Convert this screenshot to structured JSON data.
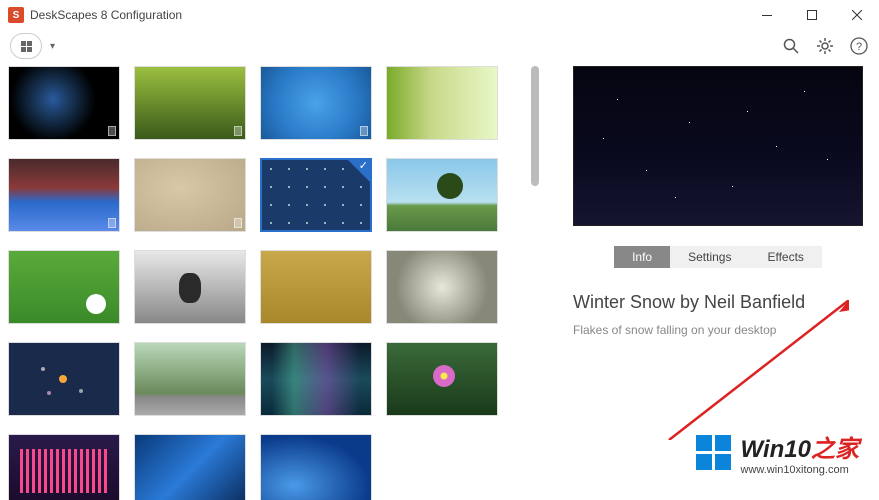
{
  "window": {
    "title": "DeskScapes 8 Configuration",
    "app_icon_letter": "S"
  },
  "details": {
    "tabs": {
      "info": "Info",
      "settings": "Settings",
      "effects": "Effects"
    },
    "title": "Winter Snow by Neil Banfield",
    "description": "Flakes of snow falling on your desktop"
  },
  "watermark": {
    "title_main": "Win10",
    "title_suffix": "之家",
    "url": "www.win10xitong.com"
  }
}
